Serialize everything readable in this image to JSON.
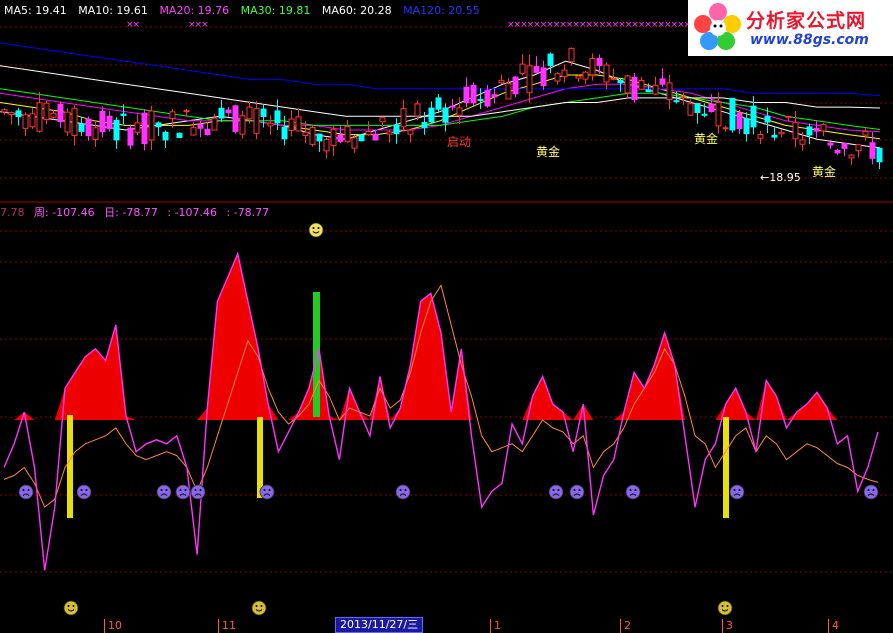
{
  "legend": {
    "ma5": "MA5: 19.41",
    "ma10": "MA10: 19.61",
    "ma20": "MA20: 19.76",
    "ma30": "MA30: 19.81",
    "ma60": "MA60: 20.28",
    "ma120": "MA120: 20.55"
  },
  "indicator_legend": {
    "cut_value": "7.78",
    "week": "周: -107.46",
    "day": "日: -78.77",
    "v1": ": -107.46",
    "v2": ": -78.77"
  },
  "logo": {
    "name": "分析家公式网",
    "url": "www.88gs.com"
  },
  "annotations": {
    "qidong": "启动",
    "huangjin1": "黄金",
    "huangjin2": "黄金",
    "huangjin3": "黄金",
    "low_price": "←18.95",
    "x_marks_1": "××",
    "x_marks_2": "×××",
    "x_marks_3": "×××××××××××××××××××××××××××××××××"
  },
  "axis": {
    "ticks": [
      "10",
      "11",
      "1",
      "2",
      "3",
      "4"
    ],
    "selected_date": "2013/11/27/三"
  },
  "colors": {
    "ma5": "#ffffff",
    "ma10": "#ffff00",
    "ma20": "#ff00ff",
    "ma30": "#00ff00",
    "ma60": "#ffffff",
    "ma120": "#0000ff",
    "up": "#ff3333",
    "down": "#00ffff",
    "magenta": "#ff33ff",
    "orange": "#ff8833",
    "red_fill": "#ee0000",
    "yellow_bar": "#e8e000",
    "green_bar": "#22cc22",
    "grid": "#8b0000"
  },
  "chart_data": [
    {
      "type": "candlestick",
      "series": [
        {
          "name": "MA5",
          "values": [
            20.2,
            20.1,
            20.0,
            19.9,
            19.8,
            19.9,
            20.0,
            20.1,
            20.0,
            19.9,
            19.7,
            19.6,
            19.8,
            20.0,
            20.2,
            20.5,
            20.8,
            21.0,
            21.3,
            21.1,
            20.8,
            20.6,
            20.4,
            20.2,
            20.0,
            19.8,
            19.6,
            19.5,
            19.41
          ]
        },
        {
          "name": "MA10",
          "values": [
            20.4,
            20.3,
            20.2,
            20.0,
            19.9,
            19.9,
            19.9,
            20.0,
            20.0,
            19.9,
            19.8,
            19.7,
            19.7,
            19.8,
            20.0,
            20.3,
            20.6,
            20.8,
            21.0,
            21.0,
            20.9,
            20.7,
            20.5,
            20.3,
            20.1,
            19.9,
            19.8,
            19.7,
            19.61
          ]
        },
        {
          "name": "MA20",
          "values": [
            20.6,
            20.5,
            20.4,
            20.3,
            20.2,
            20.1,
            20.0,
            20.0,
            20.0,
            19.9,
            19.9,
            19.8,
            19.8,
            19.8,
            19.9,
            20.1,
            20.3,
            20.5,
            20.7,
            20.8,
            20.8,
            20.7,
            20.6,
            20.4,
            20.2,
            20.0,
            19.9,
            19.8,
            19.76
          ]
        },
        {
          "name": "MA30",
          "values": [
            20.7,
            20.6,
            20.5,
            20.4,
            20.3,
            20.2,
            20.1,
            20.0,
            20.0,
            20.0,
            19.9,
            19.9,
            19.9,
            19.9,
            19.9,
            20.0,
            20.1,
            20.3,
            20.4,
            20.5,
            20.6,
            20.6,
            20.5,
            20.4,
            20.3,
            20.1,
            20.0,
            19.9,
            19.81
          ]
        },
        {
          "name": "MA60",
          "values": [
            21.2,
            21.1,
            21.0,
            20.9,
            20.8,
            20.7,
            20.6,
            20.5,
            20.4,
            20.3,
            20.2,
            20.1,
            20.1,
            20.1,
            20.1,
            20.1,
            20.2,
            20.3,
            20.4,
            20.4,
            20.5,
            20.5,
            20.5,
            20.5,
            20.4,
            20.4,
            20.3,
            20.3,
            20.28
          ]
        },
        {
          "name": "MA120",
          "values": [
            21.7,
            21.6,
            21.5,
            21.4,
            21.3,
            21.2,
            21.1,
            21.0,
            20.9,
            20.9,
            20.8,
            20.8,
            20.7,
            20.7,
            20.7,
            20.7,
            20.7,
            20.7,
            20.7,
            20.7,
            20.7,
            20.7,
            20.7,
            20.7,
            20.6,
            20.6,
            20.6,
            20.6,
            20.55
          ]
        }
      ],
      "low_marker": 18.95
    },
    {
      "type": "line",
      "series": [
        {
          "name": "周",
          "values": [
            -60,
            -30,
            10,
            -60,
            -190,
            -110,
            40,
            60,
            80,
            90,
            75,
            120,
            5,
            -40,
            -30,
            -25,
            -30,
            -20,
            -60,
            -170,
            15,
            150,
            180,
            210,
            150,
            90,
            20,
            -40,
            -15,
            10,
            40,
            90,
            5,
            -50,
            40,
            10,
            -20,
            55,
            -10,
            15,
            70,
            150,
            160,
            110,
            10,
            90,
            -20,
            -110,
            -90,
            -80,
            -5,
            -30,
            30,
            55,
            20,
            10,
            -40,
            20,
            -120,
            -70,
            -50,
            10,
            60,
            40,
            70,
            110,
            70,
            -20,
            -110,
            -50,
            -30,
            20,
            40,
            10,
            -40,
            50,
            30,
            -10,
            10,
            20,
            35,
            15,
            -30,
            -20,
            -90,
            -60,
            -15
          ]
        },
        {
          "name": "日",
          "values": [
            -75,
            -70,
            -60,
            -80,
            -110,
            -100,
            -60,
            -40,
            -30,
            -25,
            -20,
            -10,
            -30,
            -45,
            -50,
            -45,
            -40,
            -45,
            -60,
            -90,
            -60,
            -20,
            20,
            60,
            100,
            80,
            40,
            10,
            -5,
            5,
            20,
            50,
            30,
            0,
            15,
            10,
            5,
            40,
            15,
            25,
            60,
            110,
            150,
            170,
            120,
            70,
            30,
            -20,
            -40,
            -35,
            -30,
            -40,
            -20,
            0,
            -10,
            -15,
            -30,
            -20,
            -60,
            -40,
            -30,
            -10,
            20,
            40,
            60,
            90,
            70,
            30,
            -20,
            -30,
            -60,
            -40,
            -20,
            -10,
            -40,
            -20,
            -30,
            -50,
            -40,
            -30,
            -35,
            -45,
            -55,
            -60,
            -70,
            -75,
            -78.77
          ]
        }
      ]
    }
  ]
}
